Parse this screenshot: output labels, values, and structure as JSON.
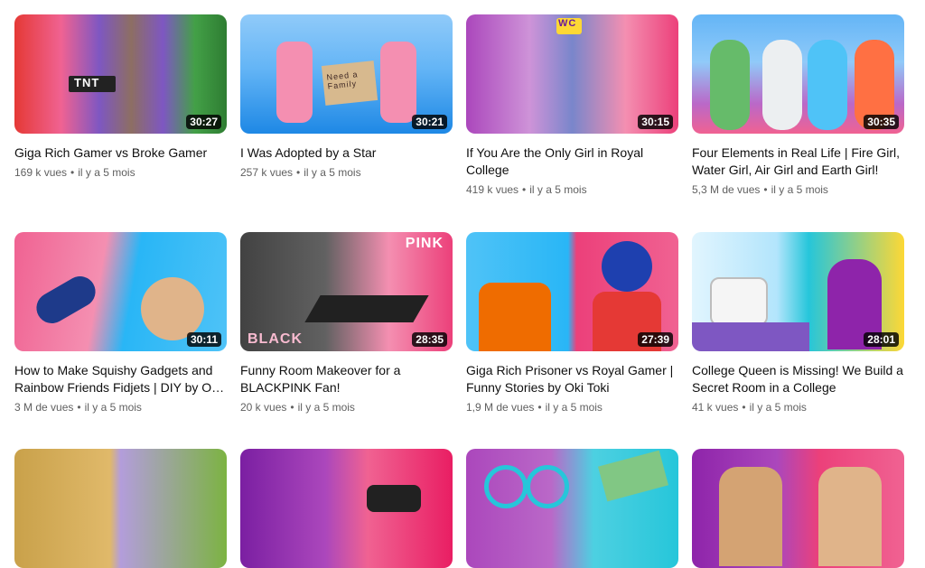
{
  "videos": [
    {
      "title": "Giga Rich Gamer vs Broke Gamer",
      "views": "169 k vues",
      "age": "il y a 5 mois",
      "duration": "30:27",
      "thumb_text": "TNT"
    },
    {
      "title": "I Was Adopted by a Star",
      "views": "257 k vues",
      "age": "il y a 5 mois",
      "duration": "30:21",
      "thumb_text": "Need a Family"
    },
    {
      "title": "If You Are the Only Girl in Royal College",
      "views": "419 k vues",
      "age": "il y a 5 mois",
      "duration": "30:15",
      "thumb_text": "WC"
    },
    {
      "title": "Four Elements in Real Life | Fire Girl, Water Girl, Air Girl and Earth Girl!",
      "views": "5,3 M de vues",
      "age": "il y a 5 mois",
      "duration": "30:35",
      "thumb_text": ""
    },
    {
      "title": "How to Make Squishy Gadgets and Rainbow Friends Fidjets | DIY by O…",
      "views": "3 M de vues",
      "age": "il y a 5 mois",
      "duration": "30:11",
      "thumb_text": ""
    },
    {
      "title": "Funny Room Makeover for a BLACKPINK Fan!",
      "views": "20 k vues",
      "age": "il y a 5 mois",
      "duration": "28:35",
      "thumb_text": "PINK",
      "thumb_text2": "BLACK"
    },
    {
      "title": "Giga Rich Prisoner vs Royal Gamer | Funny Stories by Oki Toki",
      "views": "1,9 M de vues",
      "age": "il y a 5 mois",
      "duration": "27:39",
      "thumb_text": ""
    },
    {
      "title": "College Queen is Missing! We Build a Secret Room in a College",
      "views": "41 k vues",
      "age": "il y a 5 mois",
      "duration": "28:01",
      "thumb_text": ""
    },
    {
      "title": "",
      "views": "",
      "age": "",
      "duration": "",
      "thumb_text": ""
    },
    {
      "title": "",
      "views": "",
      "age": "",
      "duration": "",
      "thumb_text": ""
    },
    {
      "title": "",
      "views": "",
      "age": "",
      "duration": "",
      "thumb_text": ""
    },
    {
      "title": "",
      "views": "",
      "age": "",
      "duration": "",
      "thumb_text": ""
    }
  ],
  "separator": "•",
  "colors": {
    "title": "#0f0f0f",
    "meta": "#606060",
    "duration_bg": "#000000"
  }
}
